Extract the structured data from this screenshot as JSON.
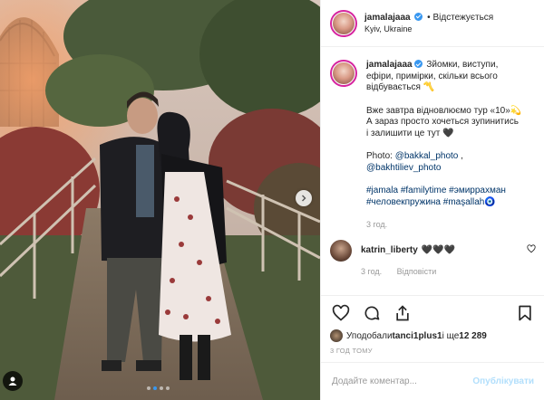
{
  "post": {
    "username": "jamalajaaa",
    "follow_status": "Відстежується",
    "location": "Kyiv, Ukraine",
    "caption_username": "jamalajaaa",
    "caption_line1": "Зйомки, виступи,",
    "caption_line2": "ефіри, примірки, скільки всього",
    "caption_line3": "відбувається 〽️",
    "caption_line4": "Вже завтра відновлюємо тур «10»💫",
    "caption_line5": "А зараз просто хочеться зупинитись",
    "caption_line6": "і залишити це тут 🖤",
    "photo_label": "Photo:",
    "photo_credit1": "@bakkal_photo",
    "photo_credit1_suffix": " ,",
    "photo_credit2": "@bakhtiliev_photo",
    "hashtags_line1": [
      "#jamala",
      "#familytime",
      "#эмиррахман"
    ],
    "hashtags_line2": [
      "#человекпружина",
      "#maşallah🧿"
    ],
    "caption_time": "3 год."
  },
  "comment": {
    "username": "katrin_liberty",
    "text": "🖤🖤🖤",
    "time": "3 год.",
    "reply_label": "Відповісти"
  },
  "likes": {
    "prefix": "Уподобали ",
    "user": "tanci1plus1",
    "middle": " і ще ",
    "count": "12 289"
  },
  "timestamp": "3 ГОД ТОМУ",
  "add_comment": {
    "placeholder": "Додайте коментар...",
    "publish_label": "Опублікувати"
  },
  "carousel": {
    "slide_count": 4,
    "active_slide": 2
  },
  "icons": {
    "like": "heart-icon",
    "comment": "comment-icon",
    "share": "share-icon",
    "save": "bookmark-icon",
    "next": "chevron-right-icon",
    "verified": "verified-badge-icon",
    "tags": "user-tag-icon"
  },
  "colors": {
    "link": "#003569",
    "verified": "#3897f0",
    "publish_disabled": "#b2dffc",
    "meta_gray": "#999999"
  }
}
